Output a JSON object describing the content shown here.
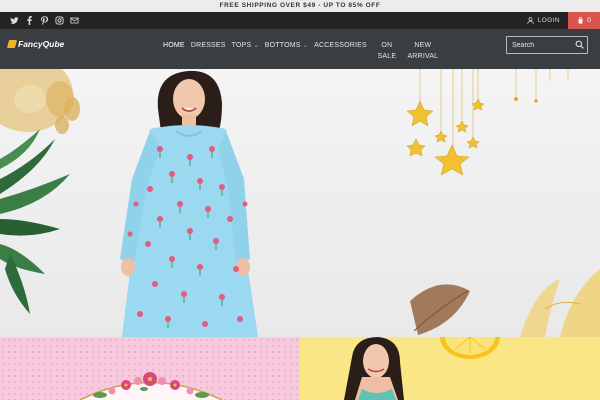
{
  "announcement": "FREE SHIPPING OVER $49 - UP TO 85% OFF",
  "topbar": {
    "social_icons": [
      "twitter-icon",
      "facebook-icon",
      "pinterest-icon",
      "instagram-icon",
      "email-icon"
    ],
    "login_label": "LOGIN",
    "cart_count": "0"
  },
  "header": {
    "logo_text": "FancyQube",
    "nav": [
      {
        "label": "HOME",
        "active": true
      },
      {
        "label": "DRESSES"
      },
      {
        "label": "TOPS",
        "dropdown": true
      },
      {
        "label": "BOTTOMS",
        "dropdown": true
      },
      {
        "label": "ACCESSORIES"
      },
      {
        "label": "ON SALE"
      },
      {
        "label": "NEW ARRIVAL"
      }
    ],
    "search_placeholder": "Search"
  },
  "colors": {
    "announcement_bg": "#ececec",
    "topbar_bg": "#232323",
    "header_bg": "#3a3d41",
    "cart_bg": "#d9534f",
    "dress": "#9ad9ef",
    "star": "#f2c12e",
    "tile_pink": "#f7c9dc",
    "tile_yellow": "#fbe685"
  }
}
